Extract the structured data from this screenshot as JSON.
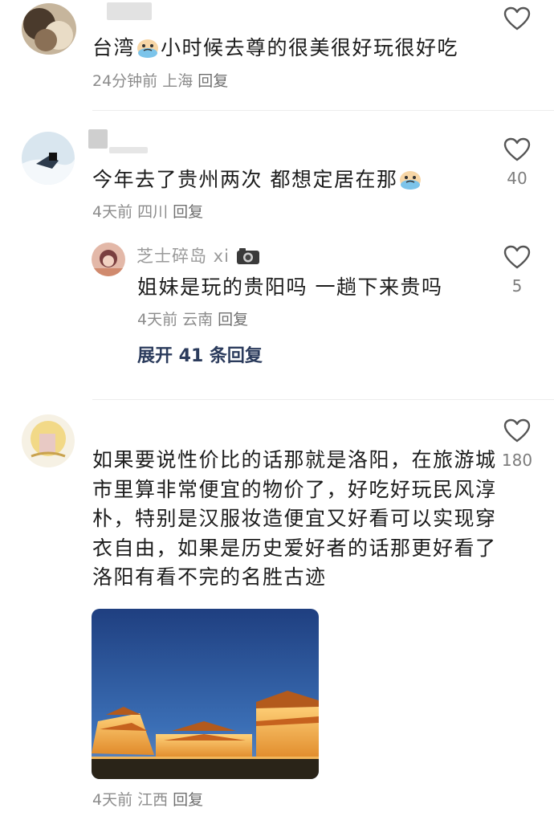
{
  "comments": [
    {
      "text_before_emoji": "台湾",
      "text_after_emoji": "小时候去尊的很美很好玩很好吃",
      "meta": {
        "time": "24分钟前",
        "location": "上海",
        "reply": "回复"
      },
      "likes": "",
      "emoji_icon": "crying-emoji-icon"
    },
    {
      "text_before_emoji": "今年去了贵州两次 都想定居在那",
      "text_after_emoji": "",
      "meta": {
        "time": "4天前",
        "location": "四川",
        "reply": "回复"
      },
      "likes": "40",
      "emoji_icon": "crying-emoji-icon",
      "reply": {
        "name": "芝士碎岛 xi",
        "name_icon": "camera-icon",
        "text": "姐妹是玩的贵阳吗 一趟下来贵吗",
        "meta": {
          "time": "4天前",
          "location": "云南",
          "reply": "回复"
        },
        "likes": "5"
      },
      "expand_label": "展开 41 条回复"
    },
    {
      "lines": [
        "如果要说性价比的话那就是洛阳，在旅游城",
        "市里算非常便宜的物价了，好吃好玩民风淳",
        "朴，特别是汉服妆造便宜又好看可以实现穿",
        "衣自由，如果是历史爱好者的话那更好看了",
        "洛阳有看不完的名胜古迹"
      ],
      "meta": {
        "time": "4天前",
        "location": "江西",
        "reply": "回复"
      },
      "likes": "180",
      "image": "night-palace-photo"
    }
  ],
  "colors": {
    "text": "#1c1c1c",
    "meta": "#8c8c8c",
    "expand": "#2b3b5c",
    "heart": "#555555"
  }
}
